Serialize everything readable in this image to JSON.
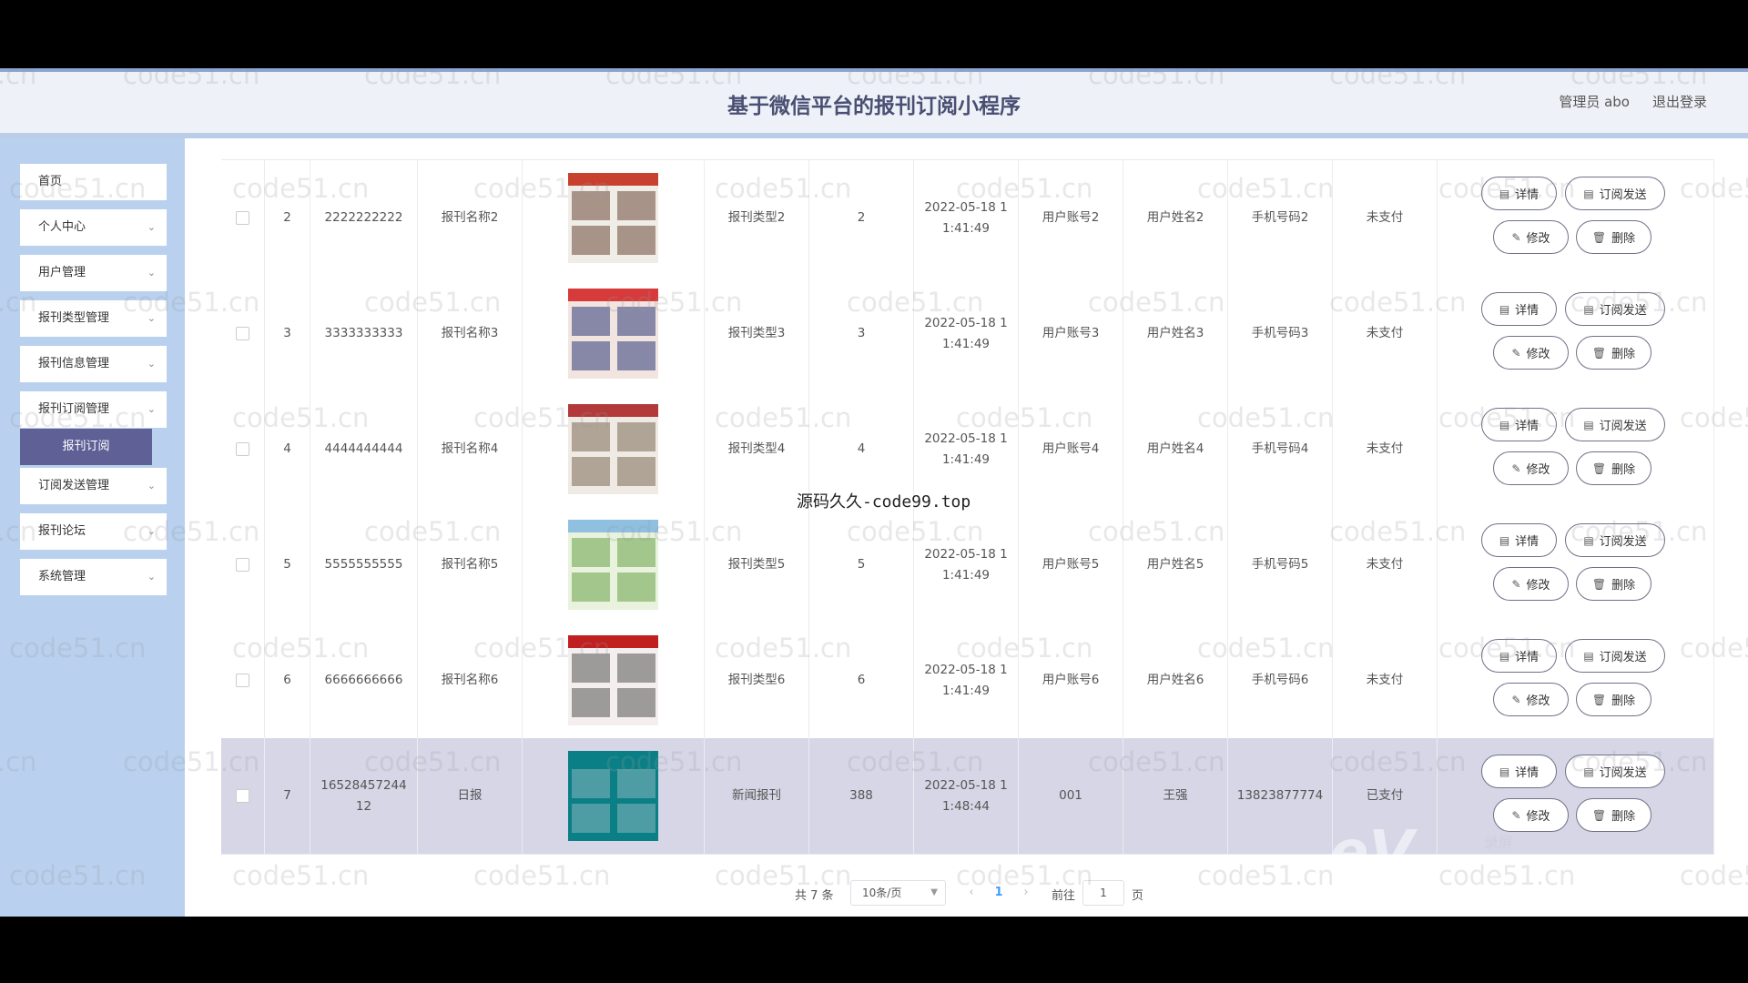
{
  "header": {
    "title": "基于微信平台的报刊订阅小程序",
    "user": "管理员 abo",
    "logout": "退出登录"
  },
  "sidebar": {
    "items": [
      {
        "label": "首页",
        "chev": ""
      },
      {
        "label": "个人中心",
        "chev": "⌄"
      },
      {
        "label": "用户管理",
        "chev": "⌄"
      },
      {
        "label": "报刊类型管理",
        "chev": "⌄"
      },
      {
        "label": "报刊信息管理",
        "chev": "⌄"
      },
      {
        "label": "报刊订阅管理",
        "chev": "⌄"
      }
    ],
    "active_sub": "报刊订阅",
    "items2": [
      {
        "label": "订阅发送管理",
        "chev": "⌄"
      },
      {
        "label": "报刊论坛",
        "chev": "⌄"
      },
      {
        "label": "系统管理",
        "chev": "⌄"
      }
    ]
  },
  "buttons": {
    "detail": "详情",
    "send": "订阅发送",
    "edit": "修改",
    "delete": "删除"
  },
  "rows": [
    {
      "idx": "2",
      "no": "2222222222",
      "name": "报刊名称2",
      "type": "报刊类型2",
      "qty": "2",
      "time": "2022-05-18 1\n1:41:49",
      "account": "用户账号2",
      "uname": "用户姓名2",
      "phone": "手机号码2",
      "status": "未支付"
    },
    {
      "idx": "3",
      "no": "3333333333",
      "name": "报刊名称3",
      "type": "报刊类型3",
      "qty": "3",
      "time": "2022-05-18 1\n1:41:49",
      "account": "用户账号3",
      "uname": "用户姓名3",
      "phone": "手机号码3",
      "status": "未支付"
    },
    {
      "idx": "4",
      "no": "4444444444",
      "name": "报刊名称4",
      "type": "报刊类型4",
      "qty": "4",
      "time": "2022-05-18 1\n1:41:49",
      "account": "用户账号4",
      "uname": "用户姓名4",
      "phone": "手机号码4",
      "status": "未支付"
    },
    {
      "idx": "5",
      "no": "5555555555",
      "name": "报刊名称5",
      "type": "报刊类型5",
      "qty": "5",
      "time": "2022-05-18 1\n1:41:49",
      "account": "用户账号5",
      "uname": "用户姓名5",
      "phone": "手机号码5",
      "status": "未支付"
    },
    {
      "idx": "6",
      "no": "6666666666",
      "name": "报刊名称6",
      "type": "报刊类型6",
      "qty": "6",
      "time": "2022-05-18 1\n1:41:49",
      "account": "用户账号6",
      "uname": "用户姓名6",
      "phone": "手机号码6",
      "status": "未支付"
    },
    {
      "idx": "7",
      "no": "16528457244\n12",
      "name": "日报",
      "type": "新闻报刊",
      "qty": "388",
      "time": "2022-05-18 1\n1:48:44",
      "account": "001",
      "uname": "王强",
      "phone": "13823877774",
      "status": "已支付"
    }
  ],
  "pagination": {
    "total": "共 7 条",
    "page_size": "10条/页",
    "current": "1",
    "goto_label": "前往",
    "goto_value": "1",
    "unit": "页"
  },
  "watermarks": {
    "site": "code51.cn",
    "center": "源码久久-code99.top",
    "logo": "eV",
    "logo_sub": "录屏"
  },
  "colors": {
    "sidebar_bg": "#b9d1ee",
    "active_menu": "#5e6096",
    "header_bg": "#eef2f8",
    "selected_row": "#d6d6e6"
  }
}
